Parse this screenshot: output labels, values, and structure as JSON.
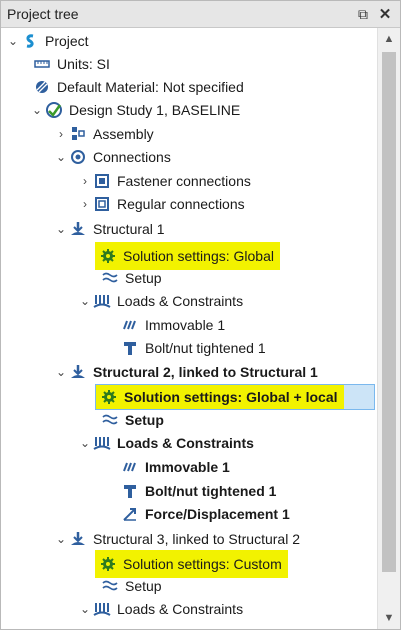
{
  "panel": {
    "title": "Project tree",
    "pin_glyph": "⧉",
    "close_glyph": "✕"
  },
  "tree": [
    {
      "label": "Project",
      "icon": "project-s-icon"
    },
    {
      "label": "Units: SI",
      "icon": "ruler-icon"
    },
    {
      "label": "Default Material: Not specified",
      "icon": "material-icon"
    },
    {
      "label": "Design Study 1, BASELINE",
      "icon": "design-study-icon"
    },
    {
      "label": "Assembly",
      "icon": "assembly-icon"
    },
    {
      "label": "Connections",
      "icon": "connections-icon"
    },
    {
      "label": "Fastener connections",
      "icon": "fastener-icon"
    },
    {
      "label": "Regular connections",
      "icon": "regular-connection-icon"
    },
    {
      "label": "Structural 1",
      "icon": "structural-icon"
    },
    {
      "label": "Solution settings: Global",
      "icon": "gear-icon"
    },
    {
      "label": "Setup",
      "icon": "setup-icon"
    },
    {
      "label": "Loads & Constraints",
      "icon": "loads-icon"
    },
    {
      "label": "Immovable 1",
      "icon": "immovable-icon"
    },
    {
      "label": "Bolt/nut tightened 1",
      "icon": "bolt-icon"
    },
    {
      "label": "Structural 2, linked to Structural 1",
      "icon": "structural-icon"
    },
    {
      "label": "Solution settings: Global + local",
      "icon": "gear-icon"
    },
    {
      "label": "Setup",
      "icon": "setup-icon"
    },
    {
      "label": "Loads & Constraints",
      "icon": "loads-icon"
    },
    {
      "label": "Immovable 1",
      "icon": "immovable-icon"
    },
    {
      "label": "Bolt/nut tightened 1",
      "icon": "bolt-icon"
    },
    {
      "label": "Force/Displacement 1",
      "icon": "force-icon"
    },
    {
      "label": "Structural 3, linked to Structural 2",
      "icon": "structural-icon"
    },
    {
      "label": "Solution settings: Custom",
      "icon": "gear-icon"
    },
    {
      "label": "Setup",
      "icon": "setup-icon"
    },
    {
      "label": "Loads & Constraints",
      "icon": "loads-icon"
    }
  ],
  "colors": {
    "highlight": "#f2f200",
    "selection": "#cce4f7",
    "icon_blue": "#2f5f9e",
    "icon_green": "#3a9a2a"
  }
}
